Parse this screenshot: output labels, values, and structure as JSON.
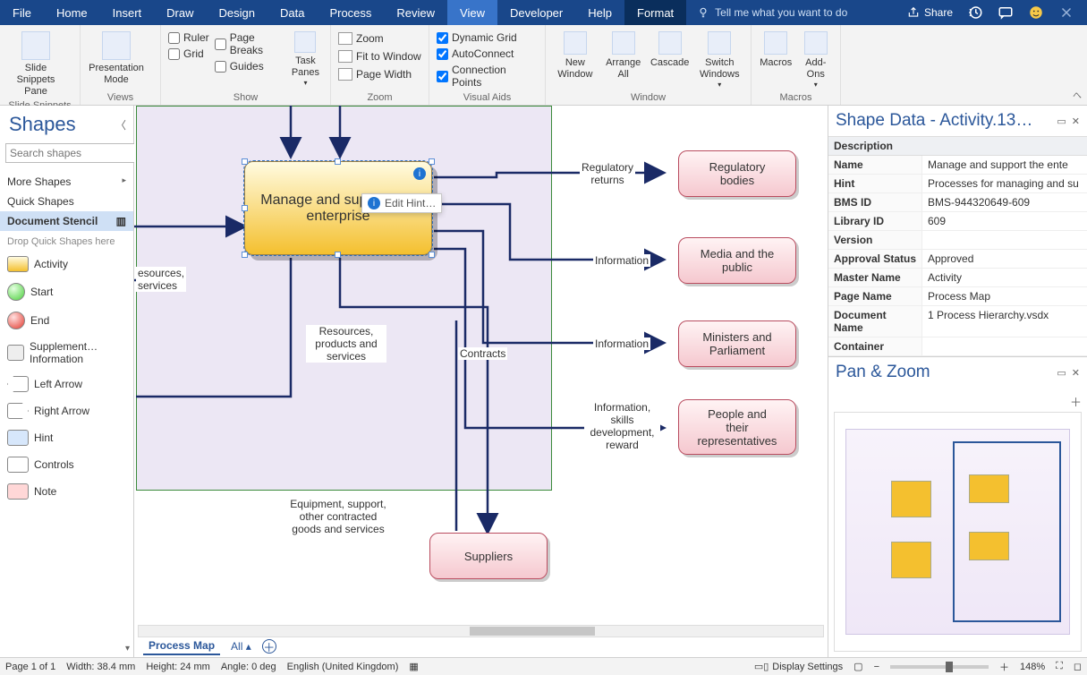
{
  "menu": {
    "tabs": [
      "File",
      "Home",
      "Insert",
      "Draw",
      "Design",
      "Data",
      "Process",
      "Review",
      "View",
      "Developer",
      "Help",
      "Format"
    ],
    "active": "View",
    "format": "Format",
    "tell_placeholder": "Tell me what you want to do",
    "share": "Share"
  },
  "ribbon": {
    "groups": {
      "slide_snippets": {
        "label": "Slide Snippets",
        "btn": "Slide\nSnippets Pane"
      },
      "views": {
        "label": "Views",
        "btn": "Presentation\nMode"
      },
      "show": {
        "label": "Show",
        "ruler": "Ruler",
        "page_breaks": "Page Breaks",
        "grid": "Grid",
        "guides": "Guides",
        "task_panes": "Task\nPanes"
      },
      "zoom": {
        "label": "Zoom",
        "zoom": "Zoom",
        "fit": "Fit to Window",
        "pagewidth": "Page Width"
      },
      "visual_aids": {
        "label": "Visual Aids",
        "dyn": "Dynamic Grid",
        "auto": "AutoConnect",
        "conn": "Connection Points"
      },
      "window": {
        "label": "Window",
        "new": "New\nWindow",
        "arrange": "Arrange\nAll",
        "cascade": "Cascade",
        "switch": "Switch\nWindows"
      },
      "macros": {
        "label": "Macros",
        "macros": "Macros",
        "addons": "Add-\nOns"
      }
    }
  },
  "shapes": {
    "title": "Shapes",
    "search_placeholder": "Search shapes",
    "more": "More Shapes",
    "quick": "Quick Shapes",
    "stencil": "Document Stencil",
    "drop_hint": "Drop Quick Shapes here",
    "items": [
      {
        "label": "Activity",
        "color": "linear-gradient(to bottom,#fffbe0,#f4c02f)"
      },
      {
        "label": "Start",
        "color": "radial-gradient(circle at 35% 30%, #e4ffe0, #4bcf3c)"
      },
      {
        "label": "End",
        "color": "radial-gradient(circle at 35% 30%, #ffe0e0, #e33a2f)"
      },
      {
        "label": "Supplement… Information",
        "color": "#eee"
      },
      {
        "label": "Left Arrow",
        "color": "#fff"
      },
      {
        "label": "Right Arrow",
        "color": "#fff"
      },
      {
        "label": "Hint",
        "color": "#d7e7fb"
      },
      {
        "label": "Controls",
        "color": "#fff"
      },
      {
        "label": "Note",
        "color": "#ffd7d7"
      }
    ]
  },
  "diagram": {
    "main_activity": "Manage and support the enterprise",
    "edit_hint": "Edit Hint…",
    "inputs_left": "esources,\nservices",
    "labels": {
      "resources": "Resources,\nproducts and\nservices",
      "contracts": "Contracts",
      "equipment": "Equipment, support,\nother contracted\ngoods and services",
      "reg": "Regulatory\nreturns",
      "info1": "Information",
      "info2": "Information",
      "people": "Information,\nskills\ndevelopment,\nreward"
    },
    "externals": {
      "suppliers": "Suppliers",
      "reg": "Regulatory\nbodies",
      "media": "Media and the\npublic",
      "ministers": "Ministers and\nParliament",
      "people": "People and\ntheir\nrepresentatives"
    }
  },
  "shape_data": {
    "title": "Shape Data - Activity.13…",
    "section": "Description",
    "rows": [
      {
        "k": "Name",
        "v": "Manage and support the ente"
      },
      {
        "k": "Hint",
        "v": "Processes for managing and su"
      },
      {
        "k": "BMS ID",
        "v": "BMS-944320649-609"
      },
      {
        "k": "Library ID",
        "v": "609"
      },
      {
        "k": "Version",
        "v": ""
      },
      {
        "k": "Approval Status",
        "v": "Approved"
      },
      {
        "k": "Master Name",
        "v": "Activity"
      },
      {
        "k": "Page Name",
        "v": "Process Map"
      },
      {
        "k": "Document Name",
        "v": "1        Process Hierarchy.vsdx"
      },
      {
        "k": "Container",
        "v": ""
      }
    ]
  },
  "panzoom": {
    "title": "Pan & Zoom"
  },
  "sheets": {
    "active": "Process Map",
    "all": "All"
  },
  "status": {
    "page": "Page 1 of 1",
    "width": "Width: 38.4 mm",
    "height": "Height: 24 mm",
    "angle": "Angle: 0 deg",
    "lang": "English (United Kingdom)",
    "display": "Display Settings",
    "zoom": "148%"
  }
}
